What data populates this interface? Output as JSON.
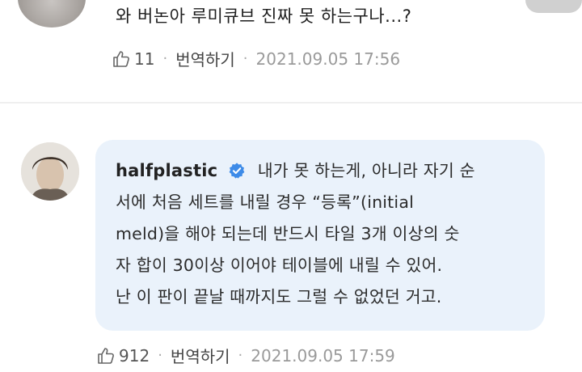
{
  "colors": {
    "bubble": "#eaf2fb",
    "verified": "#3d8be8",
    "meta_gray": "#9a9a9a"
  },
  "comment_top": {
    "text": "와 버논아 루미큐브 진짜 못 하는구나...?",
    "likes": "11",
    "translate_label": "번역하기",
    "separator": "·",
    "date": "2021.09.05 17:56"
  },
  "comment_reply": {
    "username": "halfplastic",
    "verified_icon": "verified-badge-icon",
    "lines": [
      "내가 못 하는게, 아니라 자기 순",
      "서에 처음 세트를 내릴 경우 “등록”(initial",
      "meld)을 해야 되는데 반드시 타일 3개 이상의 숫",
      "자 합이 30이상 이어야 테이블에 내릴 수 있어.",
      "난 이 판이 끝날 때까지도 그럴 수 없었던 거고."
    ],
    "likes": "912",
    "translate_label": "번역하기",
    "separator": "·",
    "date": "2021.09.05 17:59"
  }
}
